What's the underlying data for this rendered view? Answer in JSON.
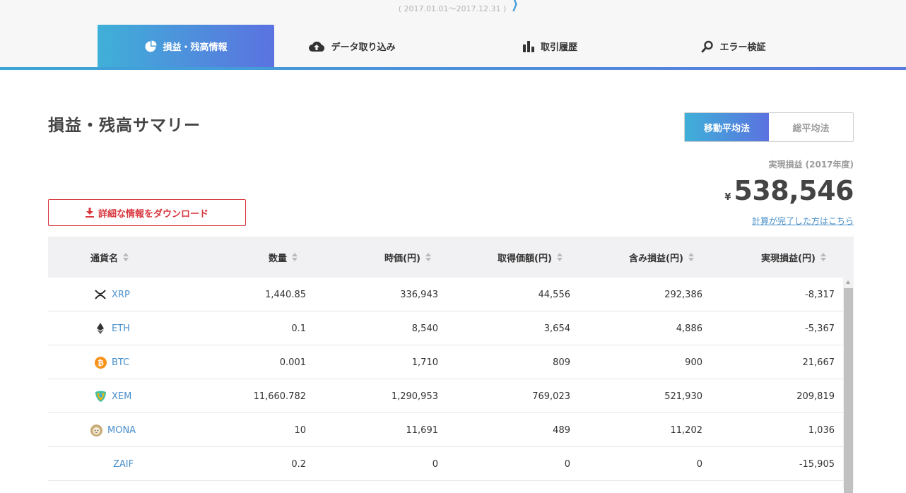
{
  "header": {
    "period": "( 2017.01.01～2017.12.31 )",
    "tabs": [
      {
        "label": "損益・残高情報",
        "icon": "pie-chart-icon",
        "active": true
      },
      {
        "label": "データ取り込み",
        "icon": "cloud-upload-icon",
        "active": false
      },
      {
        "label": "取引履歴",
        "icon": "bar-chart-icon",
        "active": false
      },
      {
        "label": "エラー検証",
        "icon": "search-icon",
        "active": false
      }
    ]
  },
  "summary": {
    "title": "損益・残高サマリー",
    "methods": [
      "移動平均法",
      "総平均法"
    ],
    "active_method": "移動平均法",
    "realized_label": "実現損益 (2017年度)",
    "currency_symbol": "¥",
    "realized_amount": "538,546",
    "calc_link": "計算が完了した方はこちら",
    "download_label": "詳細な情報をダウンロード"
  },
  "table": {
    "columns": [
      "通貨名",
      "数量",
      "時価(円)",
      "取得価額(円)",
      "含み損益(円)",
      "実現損益(円)"
    ],
    "rows": [
      {
        "coin": "XRP",
        "icon": "xrp-icon",
        "qty": "1,440.85",
        "market": "336,943",
        "cost": "44,556",
        "unrealized": "292,386",
        "realized": "-8,317"
      },
      {
        "coin": "ETH",
        "icon": "eth-icon",
        "qty": "0.1",
        "market": "8,540",
        "cost": "3,654",
        "unrealized": "4,886",
        "realized": "-5,367"
      },
      {
        "coin": "BTC",
        "icon": "btc-icon",
        "qty": "0.001",
        "market": "1,710",
        "cost": "809",
        "unrealized": "900",
        "realized": "21,667"
      },
      {
        "coin": "XEM",
        "icon": "xem-icon",
        "qty": "11,660.782",
        "market": "1,290,953",
        "cost": "769,023",
        "unrealized": "521,930",
        "realized": "209,819"
      },
      {
        "coin": "MONA",
        "icon": "mona-icon",
        "qty": "10",
        "market": "11,691",
        "cost": "489",
        "unrealized": "11,202",
        "realized": "1,036"
      },
      {
        "coin": "ZAIF",
        "icon": "",
        "qty": "0.2",
        "market": "0",
        "cost": "0",
        "unrealized": "0",
        "realized": "-15,905"
      }
    ]
  },
  "colors": {
    "accent_gradient_start": "#3fb0d8",
    "accent_gradient_end": "#5b72e0",
    "download_red": "#d9363e",
    "link_blue": "#4a8fcb"
  }
}
